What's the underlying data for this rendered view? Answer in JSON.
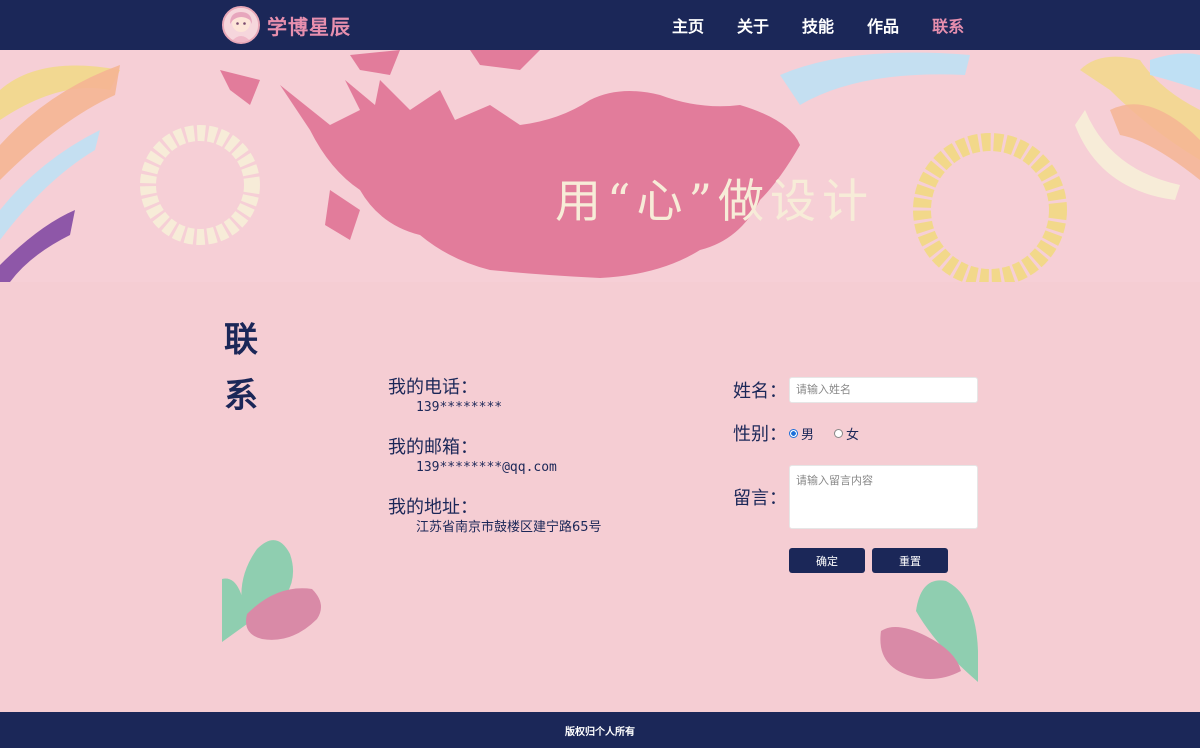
{
  "brand": {
    "name": "学博星辰"
  },
  "nav": {
    "items": [
      "主页",
      "关于",
      "技能",
      "作品",
      "联系"
    ],
    "active": "联系"
  },
  "banner": {
    "slogan": "用“心”做设计"
  },
  "section": {
    "title": "联系"
  },
  "contact": {
    "phone_label": "我的电话：",
    "phone": "139********",
    "email_label": "我的邮箱：",
    "email": "139********@qq.com",
    "address_label": "我的地址：",
    "address": "江苏省南京市鼓楼区建宁路65号"
  },
  "form": {
    "name_label": "姓名：",
    "name_placeholder": "请输入姓名",
    "gender_label": "性别：",
    "gender_options": [
      "男",
      "女"
    ],
    "gender_selected": "男",
    "message_label": "留言：",
    "message_placeholder": "请输入留言内容",
    "submit_label": "确定",
    "reset_label": "重置"
  },
  "footer": {
    "text": "版权归个人所有"
  },
  "colors": {
    "navy": "#1b2758",
    "pink_accent": "#e78fae",
    "background": "#f5cdd3"
  }
}
